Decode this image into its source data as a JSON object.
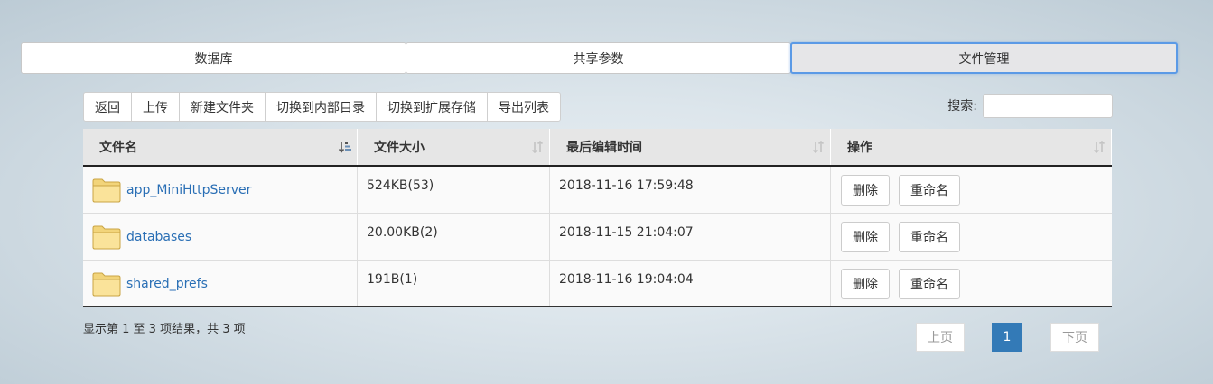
{
  "tabs": [
    {
      "label": "数据库",
      "active": false
    },
    {
      "label": "共享参数",
      "active": false
    },
    {
      "label": "文件管理",
      "active": true
    }
  ],
  "toolbar": {
    "back": "返回",
    "upload": "上传",
    "new_folder": "新建文件夹",
    "to_internal": "切换到内部目录",
    "to_external": "切换到扩展存储",
    "export_list": "导出列表"
  },
  "search": {
    "label": "搜索:",
    "value": ""
  },
  "table": {
    "headers": [
      "文件名",
      "文件大小",
      "最后编辑时间",
      "操作"
    ],
    "rows": [
      {
        "name": "app_MiniHttpServer",
        "size": "524KB(53)",
        "time": "2018-11-16 17:59:48",
        "delete": "删除",
        "rename": "重命名"
      },
      {
        "name": "databases",
        "size": "20.00KB(2)",
        "time": "2018-11-15 21:04:07",
        "delete": "删除",
        "rename": "重命名"
      },
      {
        "name": "shared_prefs",
        "size": "191B(1)",
        "time": "2018-11-16 19:04:04",
        "delete": "删除",
        "rename": "重命名"
      }
    ]
  },
  "footer": {
    "info": "显示第 1 至 3 项结果，共 3 项",
    "prev": "上页",
    "page": "1",
    "next": "下页"
  },
  "colors": {
    "accent": "#337ab7",
    "link": "#2a6fb5",
    "active_tab_border": "#5b9ae6"
  },
  "icons": {
    "sort_active": "sort-asc-icon",
    "sort_idle": "sort-both-icon",
    "folder": "folder-icon"
  }
}
